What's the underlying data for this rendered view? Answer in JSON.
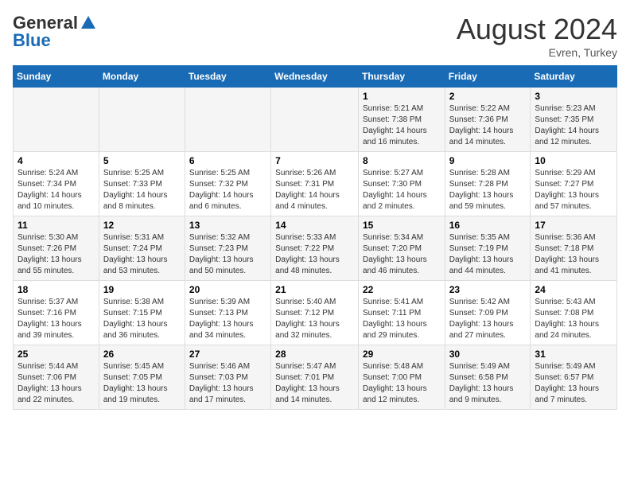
{
  "header": {
    "logo_general": "General",
    "logo_blue": "Blue",
    "month_year": "August 2024",
    "location": "Evren, Turkey"
  },
  "days_of_week": [
    "Sunday",
    "Monday",
    "Tuesday",
    "Wednesday",
    "Thursday",
    "Friday",
    "Saturday"
  ],
  "weeks": [
    {
      "days": [
        {
          "date": "",
          "info": ""
        },
        {
          "date": "",
          "info": ""
        },
        {
          "date": "",
          "info": ""
        },
        {
          "date": "",
          "info": ""
        },
        {
          "date": "1",
          "info": "Sunrise: 5:21 AM\nSunset: 7:38 PM\nDaylight: 14 hours\nand 16 minutes."
        },
        {
          "date": "2",
          "info": "Sunrise: 5:22 AM\nSunset: 7:36 PM\nDaylight: 14 hours\nand 14 minutes."
        },
        {
          "date": "3",
          "info": "Sunrise: 5:23 AM\nSunset: 7:35 PM\nDaylight: 14 hours\nand 12 minutes."
        }
      ]
    },
    {
      "days": [
        {
          "date": "4",
          "info": "Sunrise: 5:24 AM\nSunset: 7:34 PM\nDaylight: 14 hours\nand 10 minutes."
        },
        {
          "date": "5",
          "info": "Sunrise: 5:25 AM\nSunset: 7:33 PM\nDaylight: 14 hours\nand 8 minutes."
        },
        {
          "date": "6",
          "info": "Sunrise: 5:25 AM\nSunset: 7:32 PM\nDaylight: 14 hours\nand 6 minutes."
        },
        {
          "date": "7",
          "info": "Sunrise: 5:26 AM\nSunset: 7:31 PM\nDaylight: 14 hours\nand 4 minutes."
        },
        {
          "date": "8",
          "info": "Sunrise: 5:27 AM\nSunset: 7:30 PM\nDaylight: 14 hours\nand 2 minutes."
        },
        {
          "date": "9",
          "info": "Sunrise: 5:28 AM\nSunset: 7:28 PM\nDaylight: 13 hours\nand 59 minutes."
        },
        {
          "date": "10",
          "info": "Sunrise: 5:29 AM\nSunset: 7:27 PM\nDaylight: 13 hours\nand 57 minutes."
        }
      ]
    },
    {
      "days": [
        {
          "date": "11",
          "info": "Sunrise: 5:30 AM\nSunset: 7:26 PM\nDaylight: 13 hours\nand 55 minutes."
        },
        {
          "date": "12",
          "info": "Sunrise: 5:31 AM\nSunset: 7:24 PM\nDaylight: 13 hours\nand 53 minutes."
        },
        {
          "date": "13",
          "info": "Sunrise: 5:32 AM\nSunset: 7:23 PM\nDaylight: 13 hours\nand 50 minutes."
        },
        {
          "date": "14",
          "info": "Sunrise: 5:33 AM\nSunset: 7:22 PM\nDaylight: 13 hours\nand 48 minutes."
        },
        {
          "date": "15",
          "info": "Sunrise: 5:34 AM\nSunset: 7:20 PM\nDaylight: 13 hours\nand 46 minutes."
        },
        {
          "date": "16",
          "info": "Sunrise: 5:35 AM\nSunset: 7:19 PM\nDaylight: 13 hours\nand 44 minutes."
        },
        {
          "date": "17",
          "info": "Sunrise: 5:36 AM\nSunset: 7:18 PM\nDaylight: 13 hours\nand 41 minutes."
        }
      ]
    },
    {
      "days": [
        {
          "date": "18",
          "info": "Sunrise: 5:37 AM\nSunset: 7:16 PM\nDaylight: 13 hours\nand 39 minutes."
        },
        {
          "date": "19",
          "info": "Sunrise: 5:38 AM\nSunset: 7:15 PM\nDaylight: 13 hours\nand 36 minutes."
        },
        {
          "date": "20",
          "info": "Sunrise: 5:39 AM\nSunset: 7:13 PM\nDaylight: 13 hours\nand 34 minutes."
        },
        {
          "date": "21",
          "info": "Sunrise: 5:40 AM\nSunset: 7:12 PM\nDaylight: 13 hours\nand 32 minutes."
        },
        {
          "date": "22",
          "info": "Sunrise: 5:41 AM\nSunset: 7:11 PM\nDaylight: 13 hours\nand 29 minutes."
        },
        {
          "date": "23",
          "info": "Sunrise: 5:42 AM\nSunset: 7:09 PM\nDaylight: 13 hours\nand 27 minutes."
        },
        {
          "date": "24",
          "info": "Sunrise: 5:43 AM\nSunset: 7:08 PM\nDaylight: 13 hours\nand 24 minutes."
        }
      ]
    },
    {
      "days": [
        {
          "date": "25",
          "info": "Sunrise: 5:44 AM\nSunset: 7:06 PM\nDaylight: 13 hours\nand 22 minutes."
        },
        {
          "date": "26",
          "info": "Sunrise: 5:45 AM\nSunset: 7:05 PM\nDaylight: 13 hours\nand 19 minutes."
        },
        {
          "date": "27",
          "info": "Sunrise: 5:46 AM\nSunset: 7:03 PM\nDaylight: 13 hours\nand 17 minutes."
        },
        {
          "date": "28",
          "info": "Sunrise: 5:47 AM\nSunset: 7:01 PM\nDaylight: 13 hours\nand 14 minutes."
        },
        {
          "date": "29",
          "info": "Sunrise: 5:48 AM\nSunset: 7:00 PM\nDaylight: 13 hours\nand 12 minutes."
        },
        {
          "date": "30",
          "info": "Sunrise: 5:49 AM\nSunset: 6:58 PM\nDaylight: 13 hours\nand 9 minutes."
        },
        {
          "date": "31",
          "info": "Sunrise: 5:49 AM\nSunset: 6:57 PM\nDaylight: 13 hours\nand 7 minutes."
        }
      ]
    }
  ]
}
